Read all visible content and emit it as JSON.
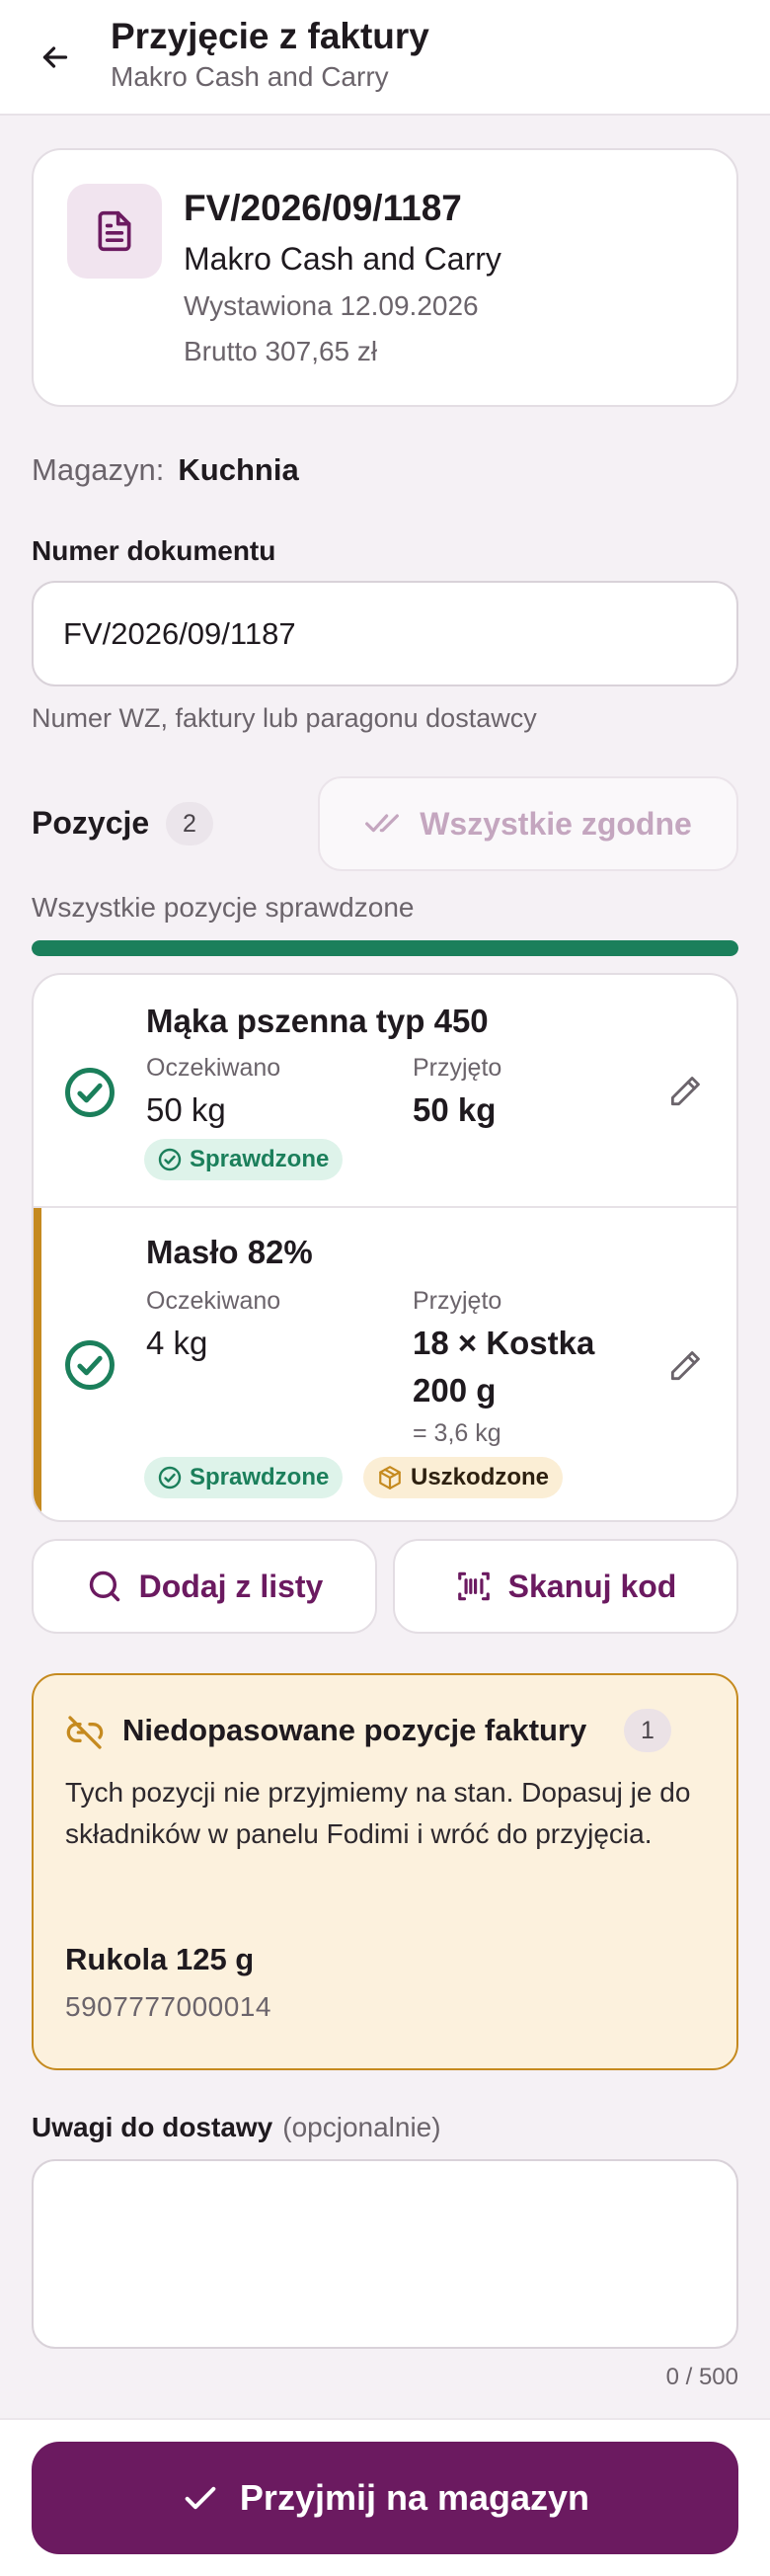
{
  "header": {
    "title": "Przyjęcie z faktury",
    "subtitle": "Makro Cash and Carry"
  },
  "document": {
    "number": "FV/2026/09/1187",
    "supplier": "Makro Cash and Carry",
    "issued": "Wystawiona 12.09.2026",
    "gross": "Brutto 307,65 zł"
  },
  "warehouse": {
    "label": "Magazyn:",
    "value": "Kuchnia"
  },
  "doc_number_field": {
    "label": "Numer dokumentu",
    "value": "FV/2026/09/1187",
    "hint": "Numer WZ, faktury lub paragonu dostawcy"
  },
  "positions": {
    "label": "Pozycje",
    "count": "2",
    "all_ok_label": "Wszystkie zgodne",
    "progress_text": "Wszystkie pozycje sprawdzone",
    "progress_fraction": 1.0,
    "expected_label": "Oczekiwano",
    "received_label": "Przyjęto",
    "items": [
      {
        "name": "Mąka pszenna typ 450",
        "expected": "50 kg",
        "received": "50 kg",
        "status": "Sprawdzone"
      },
      {
        "name": "Masło 82%",
        "expected": "4 kg",
        "received_line1": "18 × Kostka",
        "received_line2": "200 g",
        "converted": "= 3,6 kg",
        "status": "Sprawdzone",
        "flag": "Uszkodzone"
      }
    ]
  },
  "actions": {
    "add_from_list": "Dodaj z listy",
    "scan_code": "Skanuj kod"
  },
  "unmatched": {
    "title": "Niedopasowane pozycje faktury",
    "count": "1",
    "body": "Tych pozycji nie przyjmiemy na stan. Dopasuj je do składników w panelu Fodimi i wróć do przyjęcia.",
    "item_name": "Rukola 125 g",
    "item_code": "5907777000014"
  },
  "notes": {
    "label": "Uwagi do dostawy",
    "optional": "(opcjonalnie)",
    "value": "",
    "counter": "0 / 500"
  },
  "submit": {
    "label": "Przyjmij na magazyn"
  },
  "colors": {
    "primary": "#6b1a60",
    "success": "#1b7f5b",
    "warning": "#c58a1f",
    "background": "#f5f1f5"
  },
  "icons": {
    "back": "arrow-left-icon",
    "document": "file-text-icon",
    "check_all": "double-check-icon",
    "checked": "check-circle-icon",
    "edit": "pencil-icon",
    "search": "search-icon",
    "scan": "barcode-scan-icon",
    "unlink": "link-broken-icon",
    "damaged": "package-damaged-icon",
    "submit": "check-icon"
  }
}
